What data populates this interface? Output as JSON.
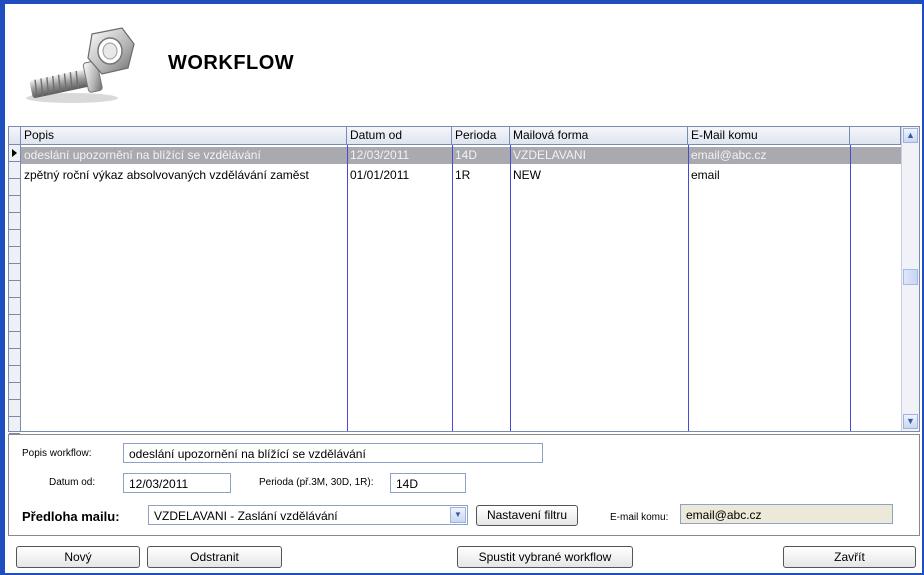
{
  "header": {
    "title": "WORKFLOW"
  },
  "grid": {
    "columns": [
      "Popis",
      "Datum od",
      "Perioda",
      "Mailová forma",
      "E-Mail komu"
    ],
    "rows": [
      [
        "odeslání upozornění na blížící se vzdělávání",
        "12/03/2011",
        "14D",
        "VZDELAVANI",
        "email@abc.cz"
      ],
      [
        "zpětný roční výkaz absolvovaných vzdělávání zaměst",
        "01/01/2011",
        "1R",
        "NEW",
        "email"
      ]
    ]
  },
  "form": {
    "popis_label": "Popis workflow:",
    "popis_value": "odeslání upozornění na blížící se vzdělávání",
    "datum_label": "Datum od:",
    "datum_value": "12/03/2011",
    "perioda_label": "Perioda (př.3M, 30D, 1R):",
    "perioda_value": "14D",
    "predloha_label": "Předloha mailu:",
    "predloha_value": "VZDELAVANI - Zaslání vzdělávání",
    "filter_button": "Nastavení filtru",
    "email_label": "E-mail komu:",
    "email_value": "email@abc.cz"
  },
  "buttons": {
    "new": "Nový",
    "delete": "Odstranit",
    "run": "Spustit vybrané workflow",
    "close": "Zavřít"
  },
  "icons": {
    "logo": "screw-nut-logo-icon",
    "scroll_up": "chevron-up-icon",
    "scroll_down": "chevron-down-icon",
    "combo": "chevron-down-icon"
  }
}
